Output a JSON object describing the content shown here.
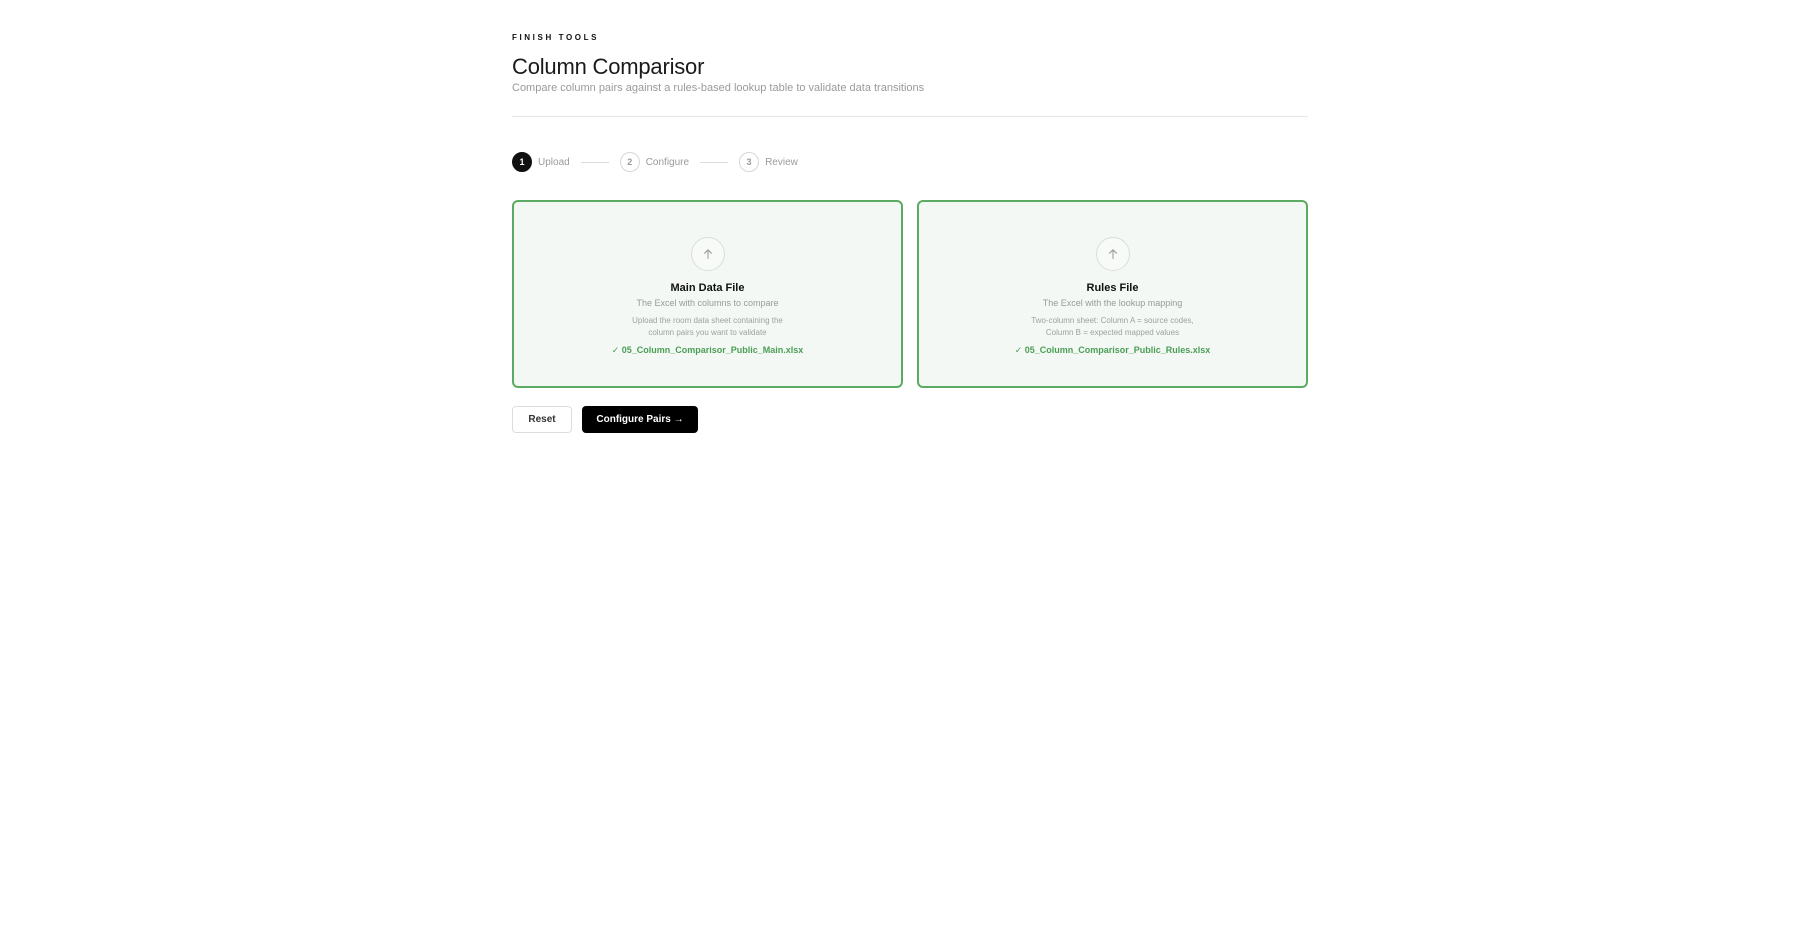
{
  "header": {
    "eyebrow": "FINISH TOOLS",
    "title": "Column Comparisor",
    "subtitle": "Compare column pairs against a rules-based lookup table to validate data transitions"
  },
  "stepper": {
    "steps": [
      {
        "number": "1",
        "label": "Upload",
        "active": true
      },
      {
        "number": "2",
        "label": "Configure",
        "active": false
      },
      {
        "number": "3",
        "label": "Review",
        "active": false
      }
    ]
  },
  "cards": [
    {
      "icon": "upload-arrow-icon",
      "title": "Main Data File",
      "subtitle": "The Excel with columns to compare",
      "desc_line1": "Upload the room data sheet containing the",
      "desc_line2": "column pairs you want to validate",
      "file": "✓ 05_Column_Comparisor_Public_Main.xlsx"
    },
    {
      "icon": "upload-arrow-icon",
      "title": "Rules File",
      "subtitle": "The Excel with the lookup mapping",
      "desc_line1": "Two-column sheet: Column A = source codes,",
      "desc_line2": "Column B = expected mapped values",
      "file": "✓ 05_Column_Comparisor_Public_Rules.xlsx"
    }
  ],
  "actions": {
    "reset_label": "Reset",
    "configure_label": "Configure Pairs →"
  },
  "colors": {
    "accent_green": "#5cab63",
    "file_green": "#4a9e55",
    "card_bg": "#f3f8f4",
    "primary": "#000000"
  }
}
